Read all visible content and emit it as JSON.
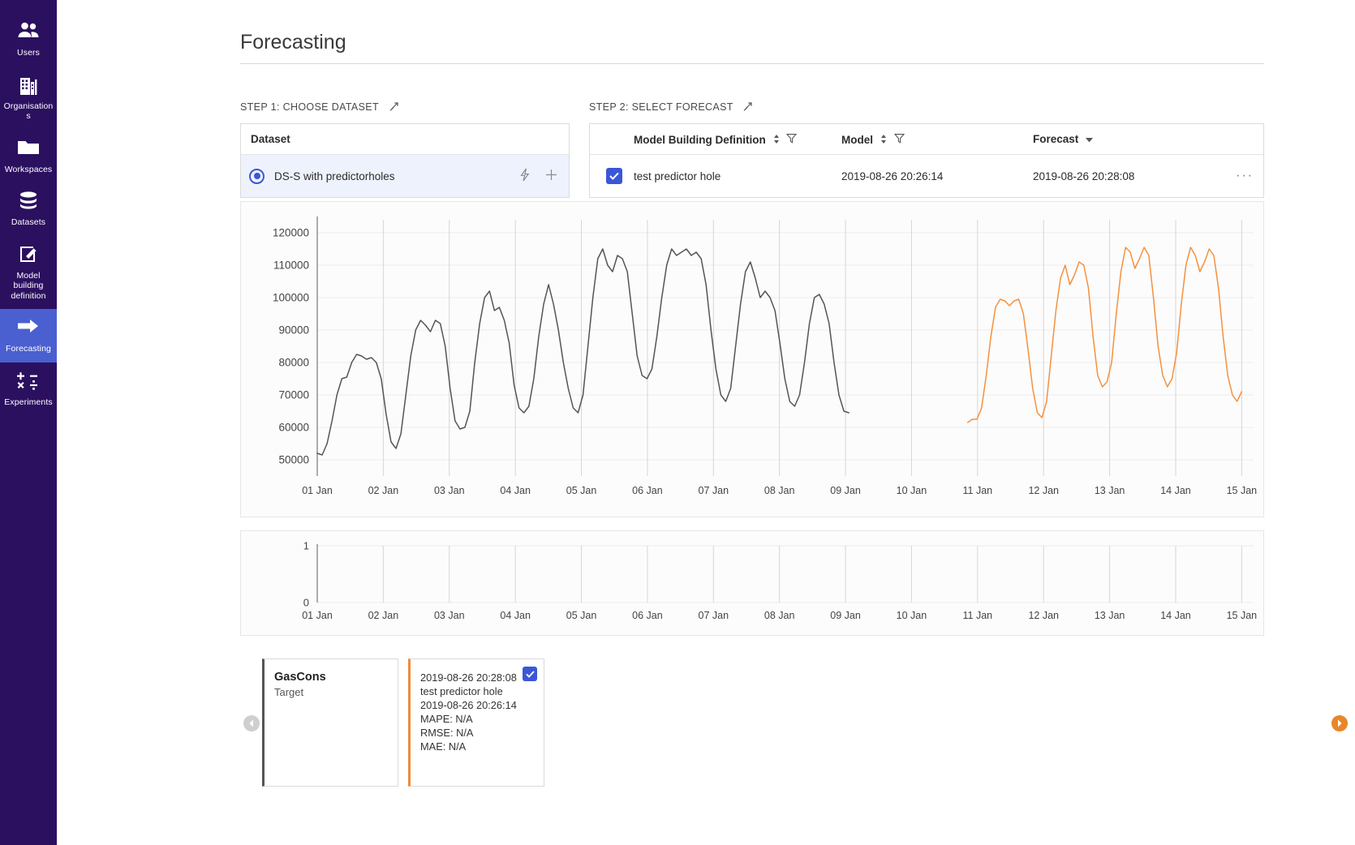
{
  "sidebar": {
    "items": [
      {
        "label": "Users",
        "icon": "users-icon",
        "active": false
      },
      {
        "label": "Organisations",
        "icon": "building-icon",
        "active": false
      },
      {
        "label": "Workspaces",
        "icon": "folder-icon",
        "active": false
      },
      {
        "label": "Datasets",
        "icon": "database-icon",
        "active": false
      },
      {
        "label": "Model building definition",
        "icon": "edit-square-icon",
        "active": false
      },
      {
        "label": "Forecasting",
        "icon": "arrow-right-icon",
        "active": true
      },
      {
        "label": "Experiments",
        "icon": "math-operators-icon",
        "active": false
      }
    ]
  },
  "header": {
    "title": "Forecasting"
  },
  "step1": {
    "label": "STEP 1: CHOOSE DATASET",
    "column_header": "Dataset",
    "rows": [
      {
        "name": "DS-S with predictorholes",
        "selected": true,
        "action_bolt": "⚡",
        "action_add": "+"
      }
    ]
  },
  "step2": {
    "label": "STEP 2: SELECT FORECAST",
    "columns": [
      "Model Building Definition",
      "Model",
      "Forecast"
    ],
    "rows": [
      {
        "checked": true,
        "model_building_definition": "test predictor hole",
        "model": "2019-08-26 20:26:14",
        "forecast": "2019-08-26 20:28:08",
        "more": "···"
      }
    ]
  },
  "legend": {
    "cards": [
      {
        "type": "target",
        "title": "GasCons",
        "subtitle": "Target",
        "color": "#555555",
        "checked": false
      },
      {
        "type": "forecast",
        "color": "#f08b3a",
        "checked": true,
        "lines": [
          "2019-08-26 20:28:08",
          "test predictor hole",
          "2019-08-26 20:26:14",
          "MAPE: N/A",
          "RMSE: N/A",
          "MAE: N/A"
        ]
      }
    ],
    "prev_label": "‹",
    "next_label": "›"
  },
  "chart_data": {
    "type": "line",
    "title": "",
    "xlabel": "",
    "ylabel": "",
    "grid": true,
    "legend_position": "below",
    "xlim": [
      "01 Jan",
      "15 Jan"
    ],
    "ylim": [
      45000,
      124000
    ],
    "yticks": [
      50000,
      60000,
      70000,
      80000,
      90000,
      100000,
      110000,
      120000
    ],
    "xticks": [
      "01 Jan",
      "02 Jan",
      "03 Jan",
      "04 Jan",
      "05 Jan",
      "06 Jan",
      "07 Jan",
      "08 Jan",
      "09 Jan",
      "10 Jan",
      "11 Jan",
      "12 Jan",
      "13 Jan",
      "14 Jan",
      "15 Jan"
    ],
    "series": [
      {
        "name": "GasCons",
        "role": "Target",
        "color": "#555555",
        "x_start_day": 1.0,
        "x_end_day": 9.05,
        "values": [
          52000,
          51500,
          55000,
          62000,
          70000,
          75000,
          75500,
          80000,
          82500,
          82000,
          81000,
          81500,
          80000,
          75000,
          64000,
          55500,
          53500,
          58000,
          70000,
          82000,
          90000,
          93000,
          91500,
          89500,
          93000,
          92000,
          85000,
          72000,
          62000,
          59500,
          60000,
          65000,
          80000,
          92000,
          100000,
          102000,
          96000,
          97000,
          93000,
          86000,
          73000,
          66000,
          64500,
          66500,
          75000,
          88000,
          98000,
          104000,
          98000,
          90000,
          80000,
          72000,
          66000,
          64500,
          70000,
          85000,
          100000,
          112000,
          115000,
          110000,
          108000,
          113000,
          112000,
          108000,
          95000,
          82000,
          76000,
          75000,
          78000,
          88000,
          100000,
          110000,
          115000,
          113000,
          114000,
          115000,
          113000,
          114000,
          112000,
          104000,
          90000,
          78000,
          70000,
          68000,
          72000,
          85000,
          98000,
          108000,
          111000,
          106000,
          100000,
          102000,
          100000,
          96000,
          86000,
          75000,
          68000,
          66500,
          70000,
          80000,
          92000,
          100000,
          101000,
          98000,
          92000,
          80000,
          70000,
          65000,
          64500
        ]
      },
      {
        "name": "Forecast 2019-08-26 20:28:08",
        "role": "Forecast",
        "color": "#f4913f",
        "x_start_day": 10.85,
        "x_end_day": 15.0,
        "values": [
          61500,
          62500,
          62500,
          66000,
          76000,
          88000,
          97000,
          99500,
          99000,
          97500,
          99000,
          99500,
          95000,
          84000,
          72000,
          64500,
          63000,
          68000,
          82000,
          96000,
          106000,
          110000,
          104000,
          107000,
          111000,
          110000,
          103000,
          88000,
          76000,
          72500,
          74000,
          80000,
          95000,
          108000,
          115500,
          114000,
          109000,
          112000,
          115500,
          113000,
          100000,
          85000,
          76000,
          72500,
          75000,
          83000,
          98000,
          110000,
          115500,
          113000,
          108000,
          111000,
          115000,
          113000,
          103000,
          88000,
          76000,
          70000,
          68000,
          71000
        ]
      }
    ],
    "mini_chart": {
      "type": "line",
      "yticks": [
        0,
        1
      ],
      "ylim": [
        0,
        1
      ],
      "xticks": [
        "01 Jan",
        "02 Jan",
        "03 Jan",
        "04 Jan",
        "05 Jan",
        "06 Jan",
        "07 Jan",
        "08 Jan",
        "09 Jan",
        "10 Jan",
        "11 Jan",
        "12 Jan",
        "13 Jan",
        "14 Jan",
        "15 Jan"
      ],
      "series": []
    }
  },
  "colors": {
    "sidebar_bg": "#2b1060",
    "sidebar_active": "#4a5fd0",
    "accent": "#3a57d8",
    "target_line": "#555555",
    "forecast_line": "#f4913f"
  }
}
